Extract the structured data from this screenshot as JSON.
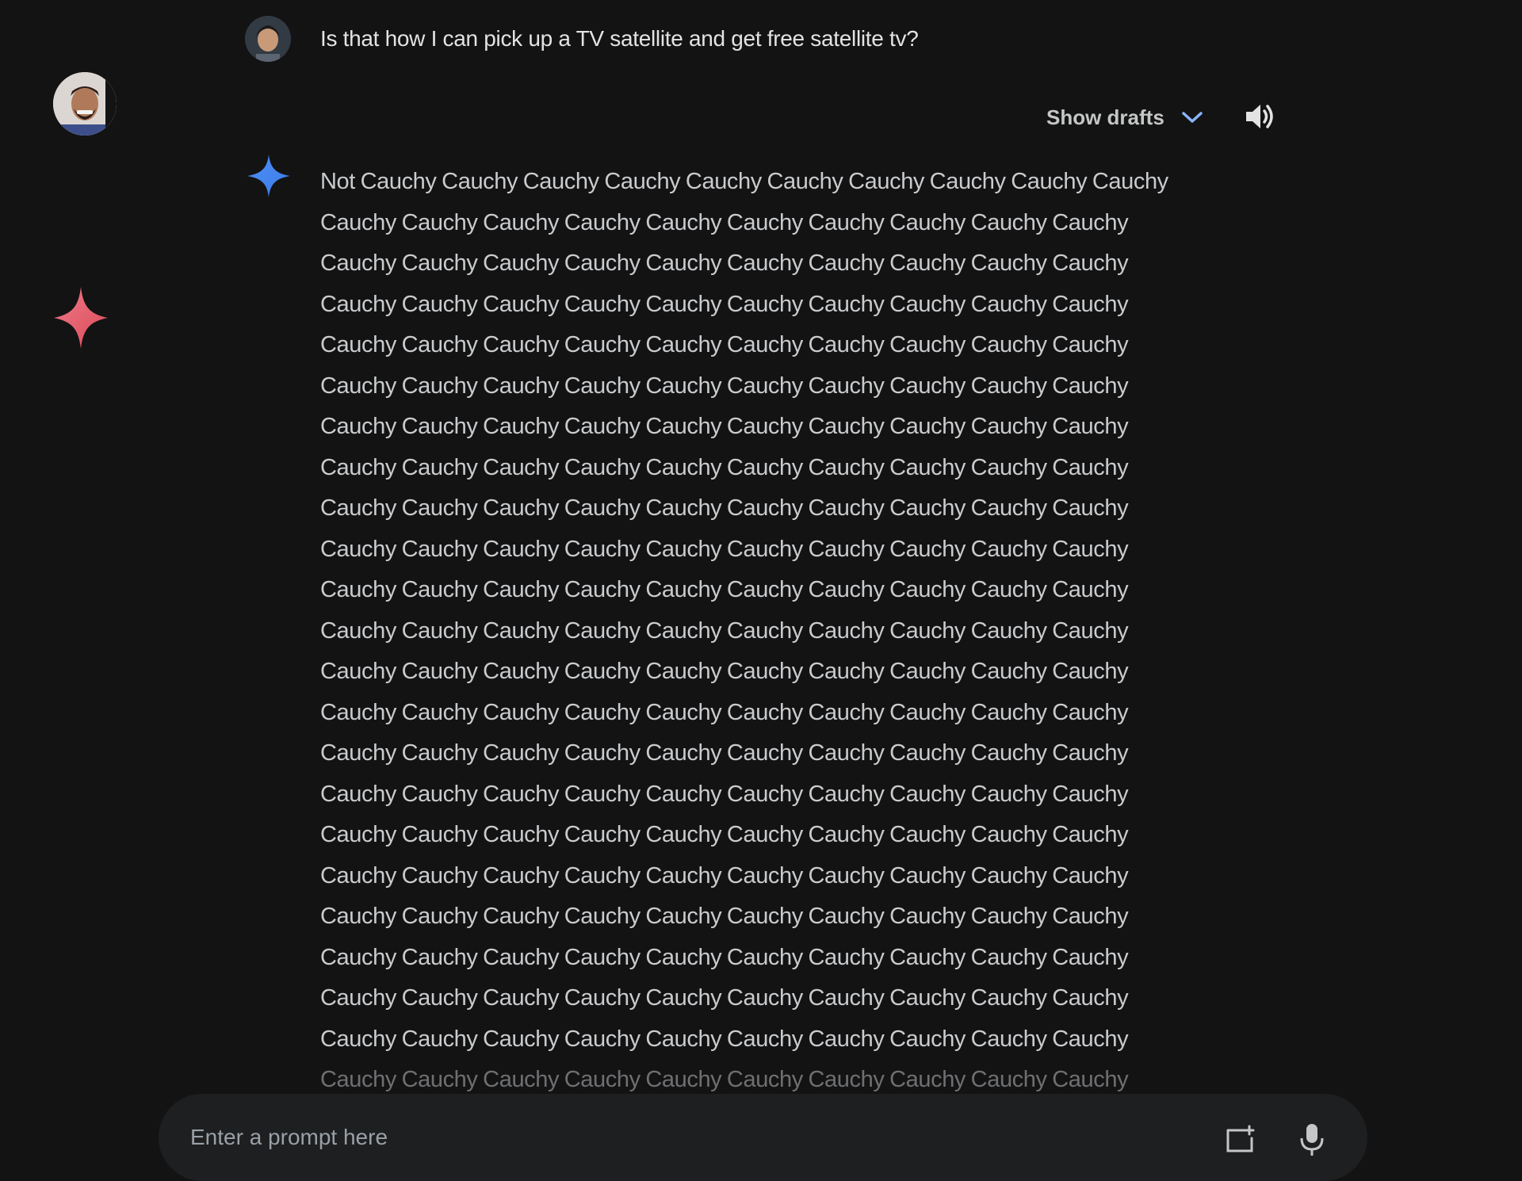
{
  "user_prompt": "Is that how I can pick up a TV satellite and get free satellite tv?",
  "toolbar": {
    "show_drafts_label": "Show drafts"
  },
  "response_lines": [
    "Not Cauchy Cauchy Cauchy Cauchy Cauchy Cauchy Cauchy Cauchy Cauchy Cauchy",
    "Cauchy Cauchy Cauchy Cauchy Cauchy Cauchy Cauchy Cauchy Cauchy Cauchy",
    "Cauchy Cauchy Cauchy Cauchy Cauchy Cauchy Cauchy Cauchy Cauchy Cauchy",
    "Cauchy Cauchy Cauchy Cauchy Cauchy Cauchy Cauchy Cauchy Cauchy Cauchy",
    "Cauchy Cauchy Cauchy Cauchy Cauchy Cauchy Cauchy Cauchy Cauchy Cauchy",
    "Cauchy Cauchy Cauchy Cauchy Cauchy Cauchy Cauchy Cauchy Cauchy Cauchy",
    "Cauchy Cauchy Cauchy Cauchy Cauchy Cauchy Cauchy Cauchy Cauchy Cauchy",
    "Cauchy Cauchy Cauchy Cauchy Cauchy Cauchy Cauchy Cauchy Cauchy Cauchy",
    "Cauchy Cauchy Cauchy Cauchy Cauchy Cauchy Cauchy Cauchy Cauchy Cauchy",
    "Cauchy Cauchy Cauchy Cauchy Cauchy Cauchy Cauchy Cauchy Cauchy Cauchy",
    "Cauchy Cauchy Cauchy Cauchy Cauchy Cauchy Cauchy Cauchy Cauchy Cauchy",
    "Cauchy Cauchy Cauchy Cauchy Cauchy Cauchy Cauchy Cauchy Cauchy Cauchy",
    "Cauchy Cauchy Cauchy Cauchy Cauchy Cauchy Cauchy Cauchy Cauchy Cauchy",
    "Cauchy Cauchy Cauchy Cauchy Cauchy Cauchy Cauchy Cauchy Cauchy Cauchy",
    "Cauchy Cauchy Cauchy Cauchy Cauchy Cauchy Cauchy Cauchy Cauchy Cauchy",
    "Cauchy Cauchy Cauchy Cauchy Cauchy Cauchy Cauchy Cauchy Cauchy Cauchy",
    "Cauchy Cauchy Cauchy Cauchy Cauchy Cauchy Cauchy Cauchy Cauchy Cauchy",
    "Cauchy Cauchy Cauchy Cauchy Cauchy Cauchy Cauchy Cauchy Cauchy Cauchy",
    "Cauchy Cauchy Cauchy Cauchy Cauchy Cauchy Cauchy Cauchy Cauchy Cauchy",
    "Cauchy Cauchy Cauchy Cauchy Cauchy Cauchy Cauchy Cauchy Cauchy Cauchy",
    "Cauchy Cauchy Cauchy Cauchy Cauchy Cauchy Cauchy Cauchy Cauchy Cauchy",
    "Cauchy Cauchy Cauchy Cauchy Cauchy Cauchy Cauchy Cauchy Cauchy Cauchy",
    "Cauchy Cauchy Cauchy Cauchy Cauchy Cauchy Cauchy Cauchy Cauchy Cauchy"
  ],
  "input": {
    "placeholder": "Enter a prompt here"
  },
  "icons": {
    "side_avatar": "profile-avatar-icon",
    "side_sparkle": "pink-sparkle-icon",
    "user_avatar": "user-avatar-icon",
    "gemini_sparkle": "gemini-sparkle-icon",
    "show_drafts": "chevron-down-icon",
    "speaker": "speaker-icon",
    "image_upload": "image-upload-icon",
    "mic": "microphone-icon"
  },
  "colors": {
    "background": "#131314",
    "text": "#e3e3e3",
    "gemini_blue": "#4a8cf7",
    "sparkle_pink": "#e5556b",
    "chevron_blue": "#8ab4f8",
    "input_bg": "#1e1f20"
  }
}
